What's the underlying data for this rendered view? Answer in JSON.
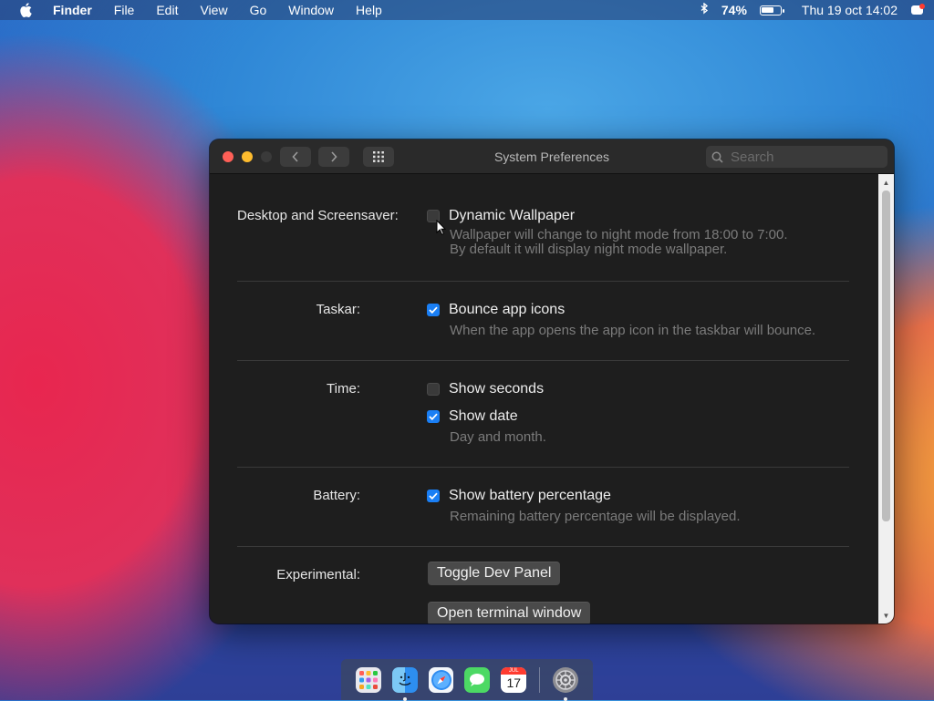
{
  "menubar": {
    "app_name": "Finder",
    "items": [
      "File",
      "Edit",
      "View",
      "Go",
      "Window",
      "Help"
    ],
    "battery_percent_text": "74%",
    "battery_level": 0.74,
    "datetime": "Thu 19 oct 14:02",
    "icons": [
      "apple-icon",
      "bluetooth-icon",
      "battery-icon",
      "notification-icon"
    ]
  },
  "window": {
    "title": "System Preferences",
    "search_placeholder": "Search",
    "sections": {
      "desktop": {
        "label": "Desktop and Screensaver:",
        "option": "Dynamic Wallpaper",
        "checked": false,
        "hint_line1": "Wallpaper will change to night mode from 18:00 to 7:00.",
        "hint_line2": "By default it will display night mode wallpaper."
      },
      "taskbar": {
        "label": "Taskar:",
        "option": "Bounce app icons",
        "checked": true,
        "hint": "When the app opens the app icon in the taskbar will bounce."
      },
      "time": {
        "label": "Time:",
        "option_seconds": "Show seconds",
        "seconds_checked": false,
        "option_date": "Show date",
        "date_checked": true,
        "hint": "Day and month."
      },
      "battery": {
        "label": "Battery:",
        "option": "Show battery percentage",
        "checked": true,
        "hint": "Remaining battery percentage will be displayed."
      },
      "experimental": {
        "label": "Experimental:",
        "button_dev_panel": "Toggle Dev Panel",
        "button_terminal": "Open terminal window"
      }
    }
  },
  "dock": {
    "apps": [
      "launchpad-icon",
      "finder-icon",
      "safari-icon",
      "messages-icon",
      "calendar-icon",
      "system-preferences-icon"
    ],
    "calendar_month": "JUL",
    "calendar_day": "17"
  },
  "colors": {
    "accent": "#1a7ff5",
    "close": "#fe5f57",
    "minimize": "#febc2e"
  }
}
